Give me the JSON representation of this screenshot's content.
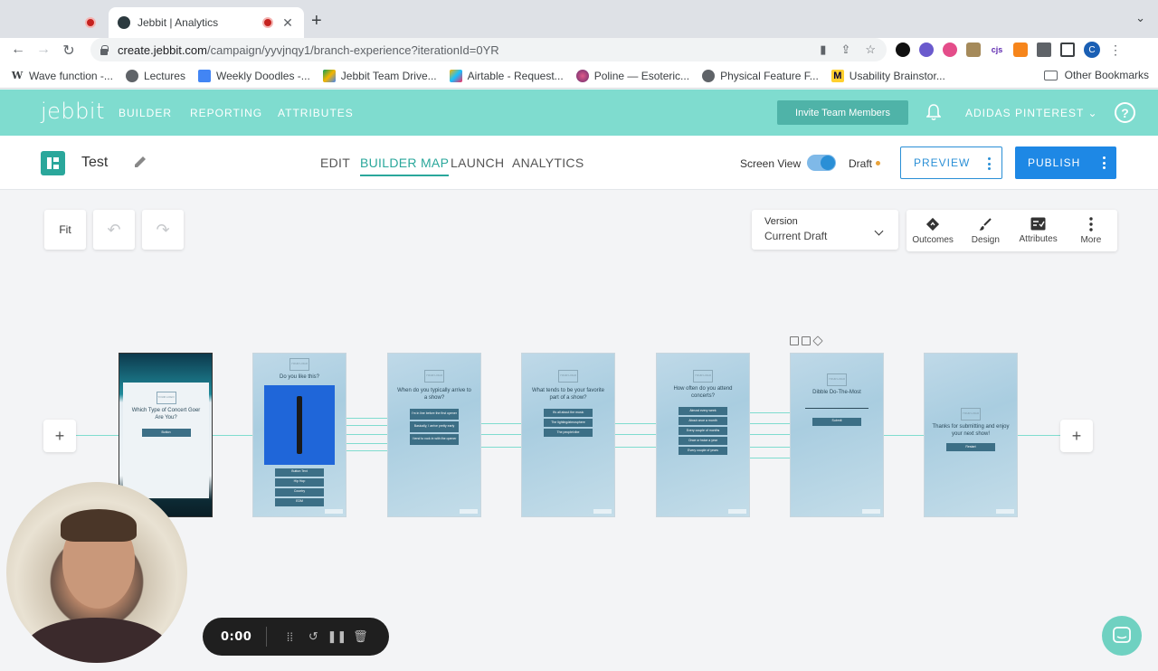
{
  "browser": {
    "tabs": [
      {
        "title": "",
        "active": false
      },
      {
        "title": "Jebbit | Analytics",
        "active": true
      }
    ],
    "url_host": "create.jebbit.com",
    "url_path": "/campaign/yyvjnqy1/branch-experience?iterationId=0YR",
    "bookmarks": [
      {
        "label": "Wave function -...",
        "icon": "wikipedia-icon"
      },
      {
        "label": "Lectures",
        "icon": "globe-icon"
      },
      {
        "label": "Weekly Doodles -...",
        "icon": "docs-icon"
      },
      {
        "label": "Jebbit Team Drive...",
        "icon": "drive-icon"
      },
      {
        "label": "Airtable - Request...",
        "icon": "airtable-icon"
      },
      {
        "label": "Poline — Esoteric...",
        "icon": "poline-icon"
      },
      {
        "label": "Physical Feature F...",
        "icon": "globe-icon"
      },
      {
        "label": "Usability Brainstor...",
        "icon": "miro-icon"
      }
    ],
    "other_bookmarks": "Other Bookmarks",
    "profile_initial": "C"
  },
  "app": {
    "logo": "jebbit",
    "nav": [
      "BUILDER",
      "REPORTING",
      "ATTRIBUTES"
    ],
    "invite_label": "Invite Team Members",
    "account_label": "ADIDAS PINTEREST",
    "help_label": "?"
  },
  "subheader": {
    "project_name": "Test",
    "modes": [
      "EDIT",
      "BUILDER MAP",
      "LAUNCH",
      "ANALYTICS"
    ],
    "active_mode": "BUILDER MAP",
    "screen_view_label": "Screen View",
    "screen_view_on": true,
    "status_label": "Draft",
    "preview_label": "PREVIEW",
    "publish_label": "PUBLISH"
  },
  "canvas_toolbar": {
    "fit_label": "Fit",
    "version_label": "Version",
    "version_value": "Current Draft",
    "actions": [
      "Outcomes",
      "Design",
      "Attributes",
      "More"
    ]
  },
  "flow": {
    "cards": [
      {
        "question": "Which Type of Concert Goer Are You?",
        "options": [
          "Button"
        ]
      },
      {
        "question": "Do you like this?",
        "options": [
          "Button Text",
          "Hip Hop",
          "Country",
          "EDM"
        ]
      },
      {
        "question": "When do you typically arrive to a show?",
        "options": [
          "I'm in line before the first opener",
          "Basically, I arrive pretty early",
          "I tend to rock in with the opener"
        ]
      },
      {
        "question": "What tends to be your favorite part of a show?",
        "options": [
          "It's all about the music",
          "The lighting/atmosphere",
          "The people/vibe"
        ]
      },
      {
        "question": "How often do you attend concerts?",
        "options": [
          "Almost every week",
          "About once a month",
          "Every couple of months",
          "Once or twice a year",
          "Every couple of years"
        ]
      },
      {
        "question": "Dibble Do-The-Most",
        "options": [
          "Submit"
        ]
      },
      {
        "question": "Thanks for submitting and enjoy your next show!",
        "options": [
          "Restart"
        ]
      }
    ]
  },
  "recorder": {
    "time": "0:00"
  }
}
